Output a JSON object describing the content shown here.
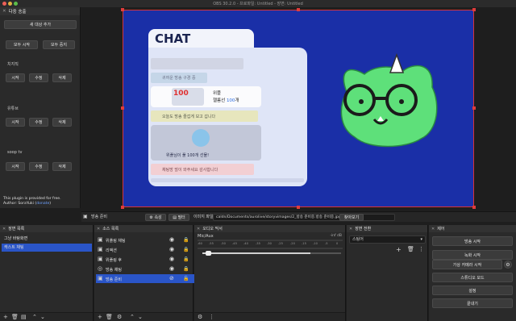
{
  "window": {
    "title": "OBS 30.2.0 - 프로파일: Untitled - 장면: Untitled"
  },
  "plugin_dock": {
    "title": "다중 송출",
    "add_target": "새 대상 추가",
    "start_all": "모두 시작",
    "stop_all": "모두 중지",
    "targets": [
      {
        "name": "치지직",
        "start": "시작",
        "edit": "수정",
        "delete": "삭제"
      },
      {
        "name": "유튜브",
        "start": "시작",
        "edit": "수정",
        "delete": "삭제"
      },
      {
        "name": "soop tv",
        "start": "시작",
        "edit": "수정",
        "delete": "삭제"
      }
    ],
    "note_line1": "This plugin is provided for free.",
    "note_line2_prefix": "Author: SoraYuki (",
    "note_line2_link": "donate",
    "note_line2_suffix": ")"
  },
  "preview": {
    "chat_title": "CHAT",
    "card1_caption": "위플",
    "card1_sub_prefix": "챌룸선",
    "card1_sub_number": "100",
    "card1_sub_suffix": "개",
    "card2_text": "위플님이 풀 100개 선물!",
    "row_texts": [
      "귀여운 방송 구경 중",
      "오늘도 방송 즐겁게 보고 갑니다",
      "채팅방 많이 와주세요 감사합니다"
    ]
  },
  "source_bar": {
    "source_name": "방송 준비",
    "properties": "속성",
    "filters": "필터",
    "image_file_label": "이미지 파일",
    "image_path": "caldn/Documents/aurolive/storyvimages/2_방송 준비중.방송 준비중.jpg",
    "browse": "찾아보기"
  },
  "scenes_dock": {
    "title": "장면 목록",
    "items": [
      "그냥 바탕화면",
      "캐스트 채팅"
    ],
    "selected_index": 1
  },
  "sources_dock": {
    "title": "소스 목록",
    "items": [
      {
        "name": "위플링 채팅",
        "icon": "image-icon"
      },
      {
        "name": "리액션",
        "icon": "image-icon"
      },
      {
        "name": "위플링 후",
        "icon": "image-icon"
      },
      {
        "name": "방송 채팅",
        "icon": "browser-icon"
      },
      {
        "name": "방송 준비",
        "icon": "image-icon"
      }
    ],
    "selected_index": 4
  },
  "audio_dock": {
    "title": "오디오 믹서",
    "channel": "Mic/Aux",
    "level_readout": "-inf dB",
    "scale": [
      "-60",
      "-55",
      "-50",
      "-45",
      "-40",
      "-35",
      "-30",
      "-25",
      "-20",
      "-15",
      "-10",
      "-5",
      "0"
    ],
    "volume_fraction": 0.78
  },
  "transitions_dock": {
    "title": "장면 전환",
    "selected": "스팅어"
  },
  "controls_dock": {
    "title": "제어",
    "buttons": [
      "방송 시작",
      "녹화 시작",
      "가상 카메라 시작",
      "스튜디오 모드",
      "설정",
      "끝내기"
    ]
  }
}
